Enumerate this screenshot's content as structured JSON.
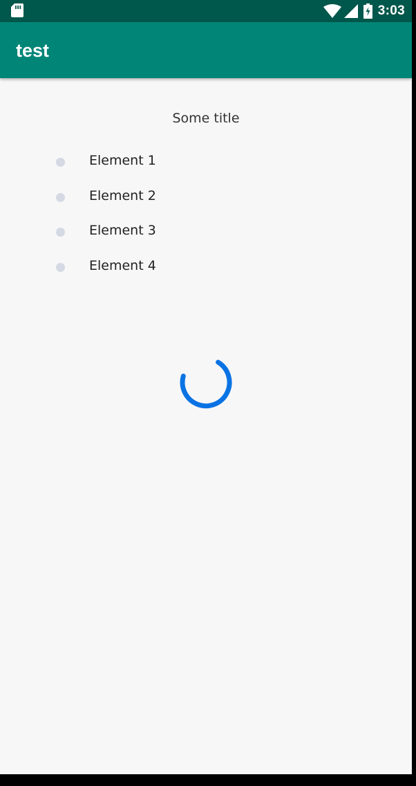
{
  "status_bar": {
    "time": "3:03",
    "icons": [
      "sd-card-icon",
      "wifi-icon",
      "cellular-signal-icon",
      "battery-charging-icon"
    ],
    "background": "#00574b"
  },
  "app_bar": {
    "title": "test",
    "background": "#008577"
  },
  "main": {
    "title": "Some title",
    "list": [
      {
        "label": "Element 1"
      },
      {
        "label": "Element 2"
      },
      {
        "label": "Element 3"
      },
      {
        "label": "Element 4"
      }
    ],
    "spinner_color": "#0a73e4"
  }
}
